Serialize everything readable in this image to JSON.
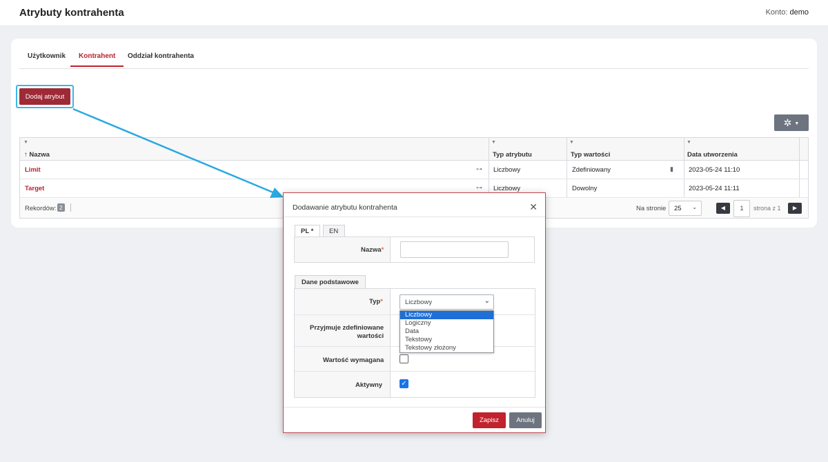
{
  "header": {
    "title": "Atrybuty kontrahenta",
    "account_label": "Konto:",
    "account_value": "demo"
  },
  "tabs": [
    {
      "label": "Użytkownik"
    },
    {
      "label": "Kontrahent"
    },
    {
      "label": "Oddział kontrahenta"
    }
  ],
  "toolbar": {
    "add_label": "Dodaj atrybut",
    "tools_icon": "asterisk-icon"
  },
  "grid": {
    "columns": [
      "Nazwa",
      "Typ atrybutu",
      "Typ wartości",
      "Data utworzenia"
    ],
    "sort_glyph": "↑",
    "rows": [
      {
        "name": "Limit",
        "attr_type": "Liczbowy",
        "value_type": "Zdefiniowany",
        "created": "2023-05-24 11:10"
      },
      {
        "name": "Target",
        "attr_type": "Liczbowy",
        "value_type": "Dowolny",
        "created": "2023-05-24 11:11"
      }
    ],
    "footer": {
      "records_label": "Rekordów:",
      "records_count": "2",
      "per_page_label": "Na stronie",
      "per_page": "25",
      "page": "1",
      "page_of": "strona z 1"
    }
  },
  "modal": {
    "title": "Dodawanie atrybutu kontrahenta",
    "lang_tabs": [
      "PL *",
      "EN"
    ],
    "name_label": "Nazwa",
    "section_label": "Dane podstawowe",
    "type_label": "Typ",
    "type_value": "Liczbowy",
    "type_options": [
      "Liczbowy",
      "Logiczny",
      "Data",
      "Tekstowy",
      "Tekstowy złożony"
    ],
    "accepts_defined_label_1": "Przyjmuje zdefiniowane",
    "accepts_defined_label_2": "wartości",
    "required_label": "Wartość wymagana",
    "active_label": "Aktywny",
    "required_asterisk": "*",
    "save_label": "Zapisz",
    "cancel_label": "Anuluj"
  },
  "colors": {
    "accent": "#b7232f",
    "primary_button": "#9e2a36",
    "highlight": "#3fb5e6",
    "select_highlight": "#1f6fd6"
  }
}
